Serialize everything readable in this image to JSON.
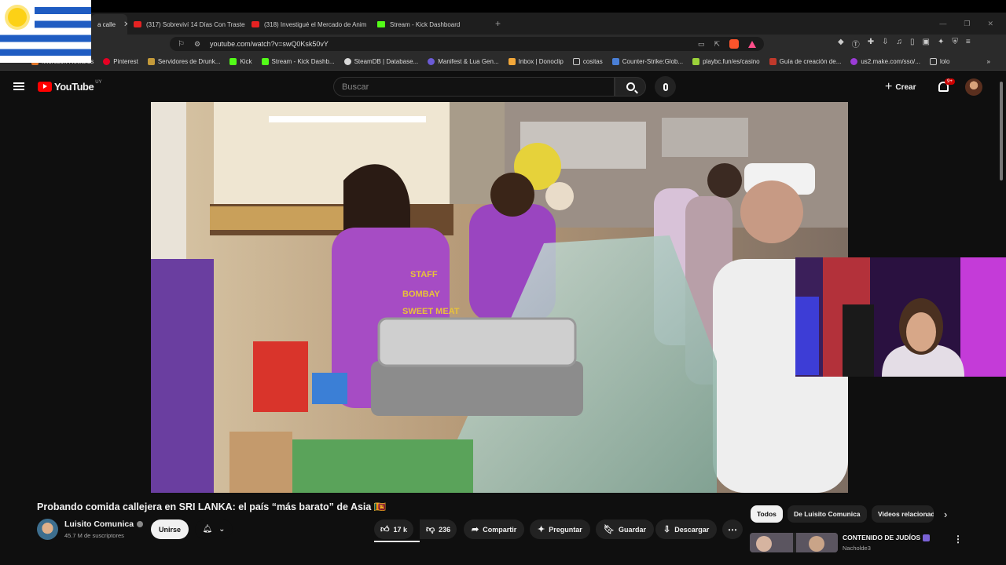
{
  "browser": {
    "tabs": [
      {
        "label": "a calle",
        "active": true
      },
      {
        "label": "(317) Sobreviví 14 Días Con Trasteros",
        "active": false
      },
      {
        "label": "(318) Investigué el Mercado de Anim",
        "active": false
      },
      {
        "label": "Stream - Kick Dashboard",
        "active": false
      }
    ],
    "new_tab": "+",
    "url": "youtube.com/watch?v=swQ0Ksk50vY",
    "bookmarks": [
      "Microsoft Rewards",
      "Pinterest",
      "Servidores de Drunk...",
      "Kick",
      "Stream - Kick Dashb...",
      "SteamDB | Database...",
      "Manifest & Lua Gen...",
      "Inbox | Donoclip",
      "cositas",
      "Counter-Strike:Glob...",
      "playbc.fun/es/casino",
      "Guía de creación de...",
      "us2.make.com/sso/...",
      "lolo"
    ],
    "bookmarks_more": "»"
  },
  "youtube": {
    "logo_text": "YouTube",
    "country_code": "UY",
    "search_placeholder": "Buscar",
    "create_label": "Crear",
    "notif_badge": "9+"
  },
  "video": {
    "title": "Probando comida callejera en SRI LANKA: el país “más barato” de Asia 🇱🇰",
    "channel_name": "Luisito Comunica",
    "subscribers": "45.7 M de suscriptores",
    "join_label": "Unirse",
    "likes": "17 k",
    "dislikes": "236",
    "share_label": "Compartir",
    "ask_label": "Preguntar",
    "save_label": "Guardar",
    "download_label": "Descargar",
    "scene_text": {
      "shirt_line1": "STAFF",
      "shirt_line2": "BOMBAY",
      "shirt_line3": "SWEET MEAT"
    }
  },
  "sidebar": {
    "chips": [
      "Todos",
      "De Luisito Comunica",
      "Videos relacionados"
    ],
    "related": {
      "title": "CONTENIDO DE JUDÍOS",
      "channel": "Nacholde3"
    }
  },
  "colors": {
    "yt_red": "#ff0000",
    "background": "#0f0f0f",
    "kick_green": "#53fc18"
  }
}
